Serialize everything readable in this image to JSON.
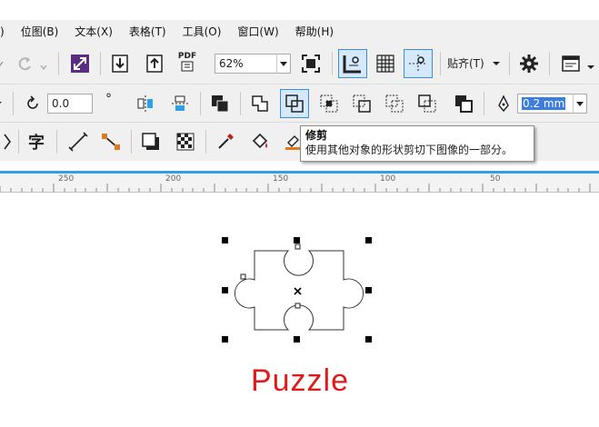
{
  "menu": [
    {
      "label": "位图(B)"
    },
    {
      "label": "文本(X)"
    },
    {
      "label": "表格(T)"
    },
    {
      "label": "工具(O)"
    },
    {
      "label": "窗口(W)"
    },
    {
      "label": "帮助(H)"
    }
  ],
  "menu_partial": "",
  "toolbar1": {
    "zoom_value": "62%",
    "snap_label": "贴齐(T)",
    "pdf_label": "PDF"
  },
  "toolbar2": {
    "angle_value": "0.0",
    "degree_symbol": "°",
    "outline_width": "0.2 mm"
  },
  "toolbar3": {
    "text_tool_glyph": "字"
  },
  "tooltip": {
    "title": "修剪",
    "description": "使用其他对象的形状剪切下图像的一部分。"
  },
  "ruler": {
    "labels": [
      "250",
      "200",
      "150",
      "100",
      "50"
    ]
  },
  "canvas": {
    "caption": "Puzzle"
  },
  "colors": {
    "accent_blue": "#30a0e6",
    "caption_red": "#e01a1a",
    "active_button": "#d6e8fb"
  }
}
